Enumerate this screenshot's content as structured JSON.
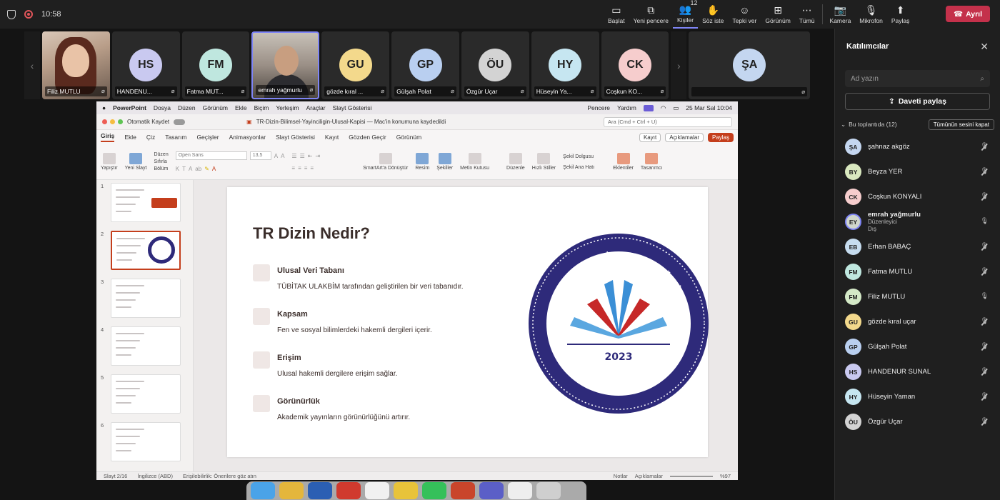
{
  "topbar": {
    "time": "10:58",
    "buttons": [
      {
        "label": "Başlat",
        "icon": "▭"
      },
      {
        "label": "Yeni pencere",
        "icon": "⧉"
      },
      {
        "label": "Kişiler",
        "icon": "👥",
        "count": "12"
      },
      {
        "label": "Söz iste",
        "icon": "✋"
      },
      {
        "label": "Tepki ver",
        "icon": "☺"
      },
      {
        "label": "Görünüm",
        "icon": "⊞"
      },
      {
        "label": "Tümü",
        "icon": "⋯"
      },
      {
        "label": "Kamera",
        "icon": "📷"
      },
      {
        "label": "Mikrofon",
        "icon": "🎙"
      },
      {
        "label": "Paylaş",
        "icon": "⬆"
      }
    ],
    "leave_label": "Ayrıl"
  },
  "strip": {
    "tiles": [
      {
        "initials": "",
        "name": "Filiz MUTLU",
        "video": true
      },
      {
        "initials": "HS",
        "name": "HANDENU...",
        "color": "#c9c9f0"
      },
      {
        "initials": "FM",
        "name": "Fatma MUT...",
        "color": "#bfe7df"
      },
      {
        "initials": "",
        "name": "emrah yağmurlu",
        "video": true
      },
      {
        "initials": "GU",
        "name": "gözde kıral ...",
        "color": "#f3d98c"
      },
      {
        "initials": "GP",
        "name": "Gülşah Polat",
        "color": "#b9cff0"
      },
      {
        "initials": "ÖU",
        "name": "Özgür Uçar",
        "color": "#d3d3d3"
      },
      {
        "initials": "HY",
        "name": "Hüseyin Ya...",
        "color": "#c6e6f1"
      },
      {
        "initials": "CK",
        "name": "Coşkun KO...",
        "color": "#f6cdcd"
      },
      {
        "initials": "ŞA",
        "name": "",
        "color": "#c4d6f0"
      }
    ]
  },
  "ppt": {
    "mac_menu": [
      "PowerPoint",
      "Dosya",
      "Düzen",
      "Görünüm",
      "Ekle",
      "Biçim",
      "Yerleşim",
      "Araçlar",
      "Slayt Gösterisi"
    ],
    "mac_right": [
      "Pencere",
      "Yardım"
    ],
    "mac_clock": "25 Mar Sal  10:04",
    "autosave": "Otomatik Kaydet",
    "doc_title": "TR-Dizin-Bilimsel-Yayinciligin-Ulusal-Kapisi — Mac'in konumuna kaydedildi",
    "search_placeholder": "Ara (Cmd + Ctrl + U)",
    "tabs": [
      "Giriş",
      "Ekle",
      "Çiz",
      "Tasarım",
      "Geçişler",
      "Animasyonlar",
      "Slayt Gösterisi",
      "Kayıt",
      "Gözden Geçir",
      "Görünüm"
    ],
    "record": "Kayıt",
    "comments": "Açıklamalar",
    "share": "Paylaş",
    "ribbon": {
      "paste": "Yapıştır",
      "new_slide": "Yeni Slayt",
      "layout": "Düzen",
      "reset": "Sıfırla",
      "section": "Bölüm",
      "font": "Open Sans",
      "size": "13,5",
      "smartart": "SmartArt'a Dönüştür",
      "picture": "Resim",
      "shapes": "Şekiller",
      "textbox": "Metin Kutusu",
      "arrange": "Düzenle",
      "quick_styles": "Hızlı Stiller",
      "shape_outline": "Şekil Dolgusu",
      "shape_effects": "Şekil Ana Hatı",
      "addins": "Eklentiler",
      "designer": "Tasarımcı"
    },
    "thumb_numbers": [
      "1",
      "2",
      "3",
      "4",
      "5",
      "6"
    ],
    "slide": {
      "title": "TR Dizin Nedir?",
      "items": [
        {
          "h": "Ulusal Veri Tabanı",
          "d": "TÜBİTAK ULAKBİM tarafından geliştirilen bir veri tabanıdır."
        },
        {
          "h": "Kapsam",
          "d": "Fen ve sosyal bilimlerdeki hakemli dergileri içerir."
        },
        {
          "h": "Erişim",
          "d": "Ulusal hakemli dergilere erişim sağlar."
        },
        {
          "h": "Görünürlük",
          "d": "Akademik yayınların görünürlüğünü artırır."
        }
      ],
      "seal_year": "2023",
      "seal_text_top": "ÇANAKKALE ONSEKİZ MART ÜNİVERSİTESİ",
      "seal_text_bottom": "BİLİMSEL YAYIN VE DERGİLER KOORDİNATÖRLÜĞÜ"
    },
    "status": {
      "slide": "Slayt 2/16",
      "lang": "İngilizce (ABD)",
      "access": "Erişilebilirlik: Önerilere göz atın",
      "notes": "Notlar",
      "comments": "Açıklamalar",
      "zoom": "%97"
    }
  },
  "panel": {
    "title": "Katılımcılar",
    "search_placeholder": "Ad yazın",
    "invite": "Daveti paylaş",
    "group": "Bu toplantıda (12)",
    "mute_all": "Tümünün sesini kapat",
    "people": [
      {
        "initials": "ŞA",
        "name": "şahnaz akgöz",
        "color": "#c4d6f0",
        "mic": "off"
      },
      {
        "initials": "BY",
        "name": "Beyza YER",
        "color": "#d9e8bf",
        "mic": "off"
      },
      {
        "initials": "CK",
        "name": "Coşkun KONYALI",
        "color": "#f6cdcd",
        "mic": "off"
      },
      {
        "initials": "EY",
        "name": "emrah yağmurlu",
        "sub1": "Düzenleyici",
        "sub2": "Dış",
        "color": "#d0d6cc",
        "mic": "on"
      },
      {
        "initials": "EB",
        "name": "Erhan BABAÇ",
        "color": "#c6dcef",
        "mic": "off"
      },
      {
        "initials": "FM",
        "name": "Fatma MUTLU",
        "color": "#bfe7df",
        "mic": "off"
      },
      {
        "initials": "FM",
        "name": "Filiz MUTLU",
        "color": "#d4e9c7",
        "mic": "on"
      },
      {
        "initials": "GU",
        "name": "gözde kıral uçar",
        "color": "#f3d98c",
        "mic": "off"
      },
      {
        "initials": "GP",
        "name": "Gülşah Polat",
        "color": "#b9cff0",
        "mic": "off"
      },
      {
        "initials": "HS",
        "name": "HANDENUR SUNAL",
        "color": "#c9c9f0",
        "mic": "off"
      },
      {
        "initials": "HY",
        "name": "Hüseyin Yaman",
        "color": "#c6e6f1",
        "mic": "off"
      },
      {
        "initials": "ÖU",
        "name": "Özgür Uçar",
        "color": "#d3d3d3",
        "mic": "off"
      }
    ]
  }
}
